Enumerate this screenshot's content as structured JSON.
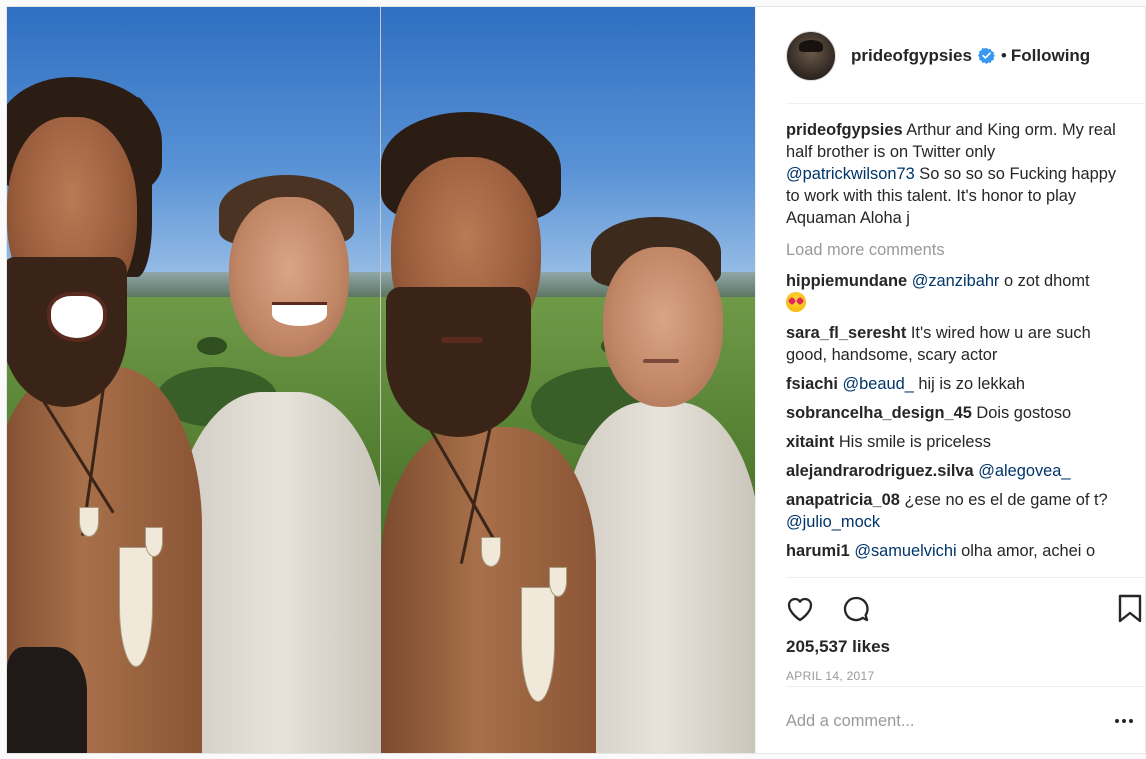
{
  "post": {
    "author": "prideofgypsies",
    "follow_state": "Following",
    "separator": "•",
    "verified": true,
    "caption": {
      "user": "prideofgypsies",
      "text_before": "Arthur and King orm. My real half brother is on Twitter only",
      "mention": "@patrickwilson73",
      "text_after": "So so so so Fucking happy to work with this talent. It's honor to play Aquaman Aloha j"
    },
    "load_more": "Load more comments",
    "comments": [
      {
        "user": "hippiemundane",
        "mention": "@zanzibahr",
        "text": "o zot dhomt",
        "emoji": "heart-eyes"
      },
      {
        "user": "sara_fl_seresht",
        "mention": "",
        "text": "It's wired how u are such good, handsome, scary actor"
      },
      {
        "user": "fsiachi",
        "mention": "@beaud_",
        "text": "hij is zo lekkah"
      },
      {
        "user": "sobrancelha_design_45",
        "mention": "",
        "text": "Dois gostoso"
      },
      {
        "user": "xitaint",
        "mention": "",
        "text": "His smile is priceless"
      },
      {
        "user": "alejandrarodriguez.silva",
        "mention": "@alegovea_",
        "text": ""
      },
      {
        "user": "anapatricia_08",
        "mention": "",
        "text": "¿ese no es el de game of t?",
        "mention_after": "@julio_mock"
      },
      {
        "user": "harumi1",
        "mention": "@samuelvichi",
        "text": "olha amor, achei o"
      }
    ],
    "likes": "205,537 likes",
    "date": "APRIL 14, 2017",
    "add_comment_placeholder": "Add a comment..."
  },
  "icons": {
    "like": "heart-outline-icon",
    "comment": "speech-bubble-icon",
    "save": "bookmark-icon",
    "more": "ellipsis-icon",
    "verified": "verified-badge-icon"
  },
  "colors": {
    "verified_badge": "#3897f0",
    "mention": "#003569",
    "muted": "#999999",
    "text": "#262626"
  }
}
